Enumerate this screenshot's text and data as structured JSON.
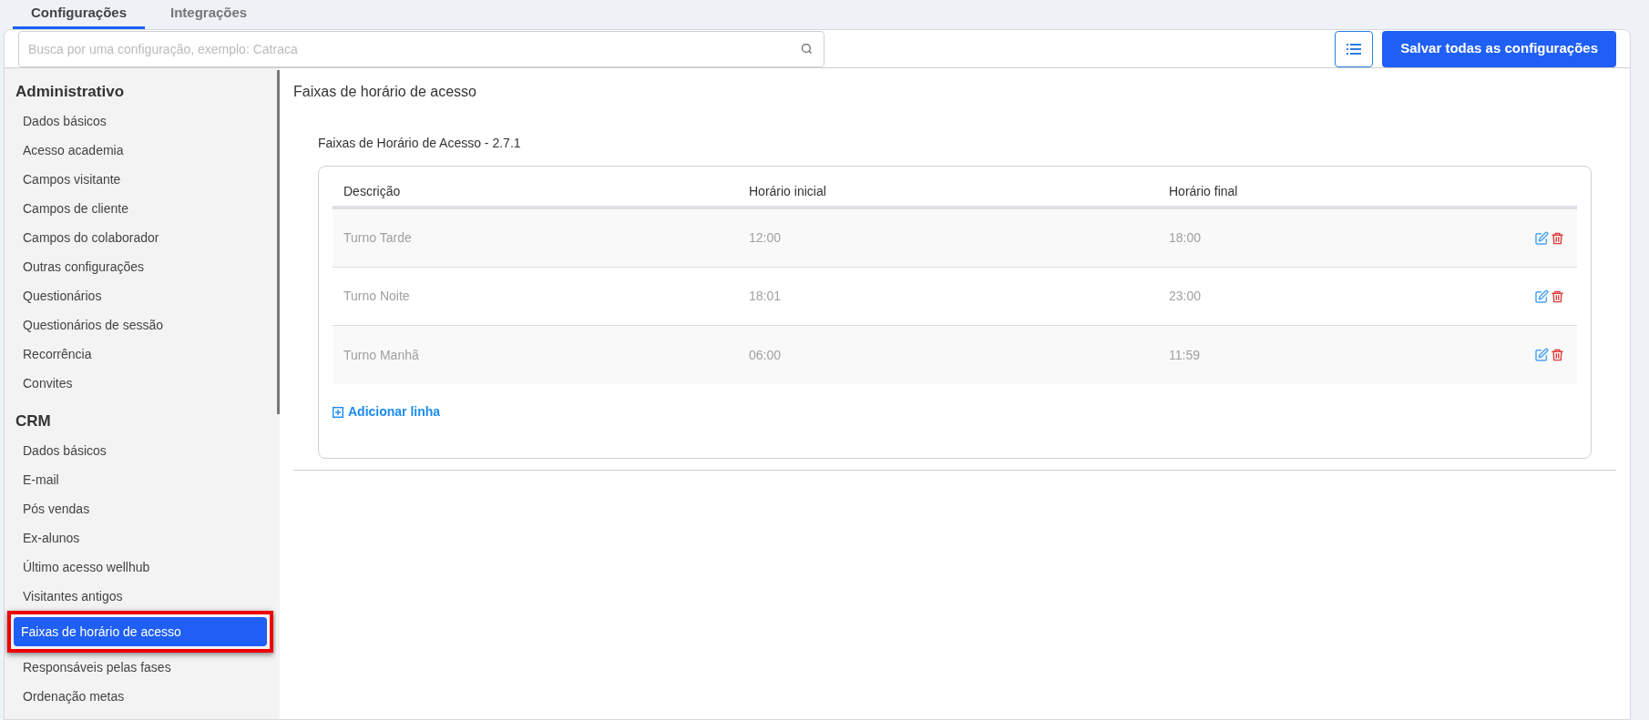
{
  "tabs": [
    {
      "label": "Configurações",
      "selected": true
    },
    {
      "label": "Integrações",
      "selected": false
    }
  ],
  "search": {
    "placeholder": "Busca por uma configuração, exemplo: Catraca"
  },
  "save_button": "Salvar todas as configurações",
  "sidebar": {
    "sections": [
      {
        "title": "Administrativo",
        "items": [
          {
            "label": "Dados básicos",
            "selected": false,
            "annotated": false
          },
          {
            "label": "Acesso academia",
            "selected": false,
            "annotated": false
          },
          {
            "label": "Campos visitante",
            "selected": false,
            "annotated": false
          },
          {
            "label": "Campos de cliente",
            "selected": false,
            "annotated": false
          },
          {
            "label": "Campos do colaborador",
            "selected": false,
            "annotated": false
          },
          {
            "label": "Outras configurações",
            "selected": false,
            "annotated": false
          },
          {
            "label": "Questionários",
            "selected": false,
            "annotated": false
          },
          {
            "label": "Questionários de sessão",
            "selected": false,
            "annotated": false
          },
          {
            "label": "Recorrência",
            "selected": false,
            "annotated": false
          },
          {
            "label": "Convites",
            "selected": false,
            "annotated": false
          }
        ]
      },
      {
        "title": "CRM",
        "items": [
          {
            "label": "Dados básicos",
            "selected": false,
            "annotated": false
          },
          {
            "label": "E-mail",
            "selected": false,
            "annotated": false
          },
          {
            "label": "Pós vendas",
            "selected": false,
            "annotated": false
          },
          {
            "label": "Ex-alunos",
            "selected": false,
            "annotated": false
          },
          {
            "label": "Último acesso wellhub",
            "selected": false,
            "annotated": false
          },
          {
            "label": "Visitantes antigos",
            "selected": false,
            "annotated": false
          },
          {
            "label": "Faixas de horário de acesso",
            "selected": true,
            "annotated": true
          },
          {
            "label": "Responsáveis pelas fases",
            "selected": false,
            "annotated": false
          },
          {
            "label": "Ordenação metas",
            "selected": false,
            "annotated": false
          }
        ]
      }
    ]
  },
  "main": {
    "title": "Faixas de horário de acesso",
    "section_title": "Faixas de Horário de Acesso - 2.7.1",
    "table": {
      "columns": [
        "Descrição",
        "Horário inicial",
        "Horário final"
      ],
      "rows": [
        [
          "Turno Tarde",
          "12:00",
          "18:00"
        ],
        [
          "Turno Noite",
          "18:01",
          "23:00"
        ],
        [
          "Turno Manhã",
          "06:00",
          "11:59"
        ]
      ]
    },
    "add_row": "Adicionar linha"
  }
}
